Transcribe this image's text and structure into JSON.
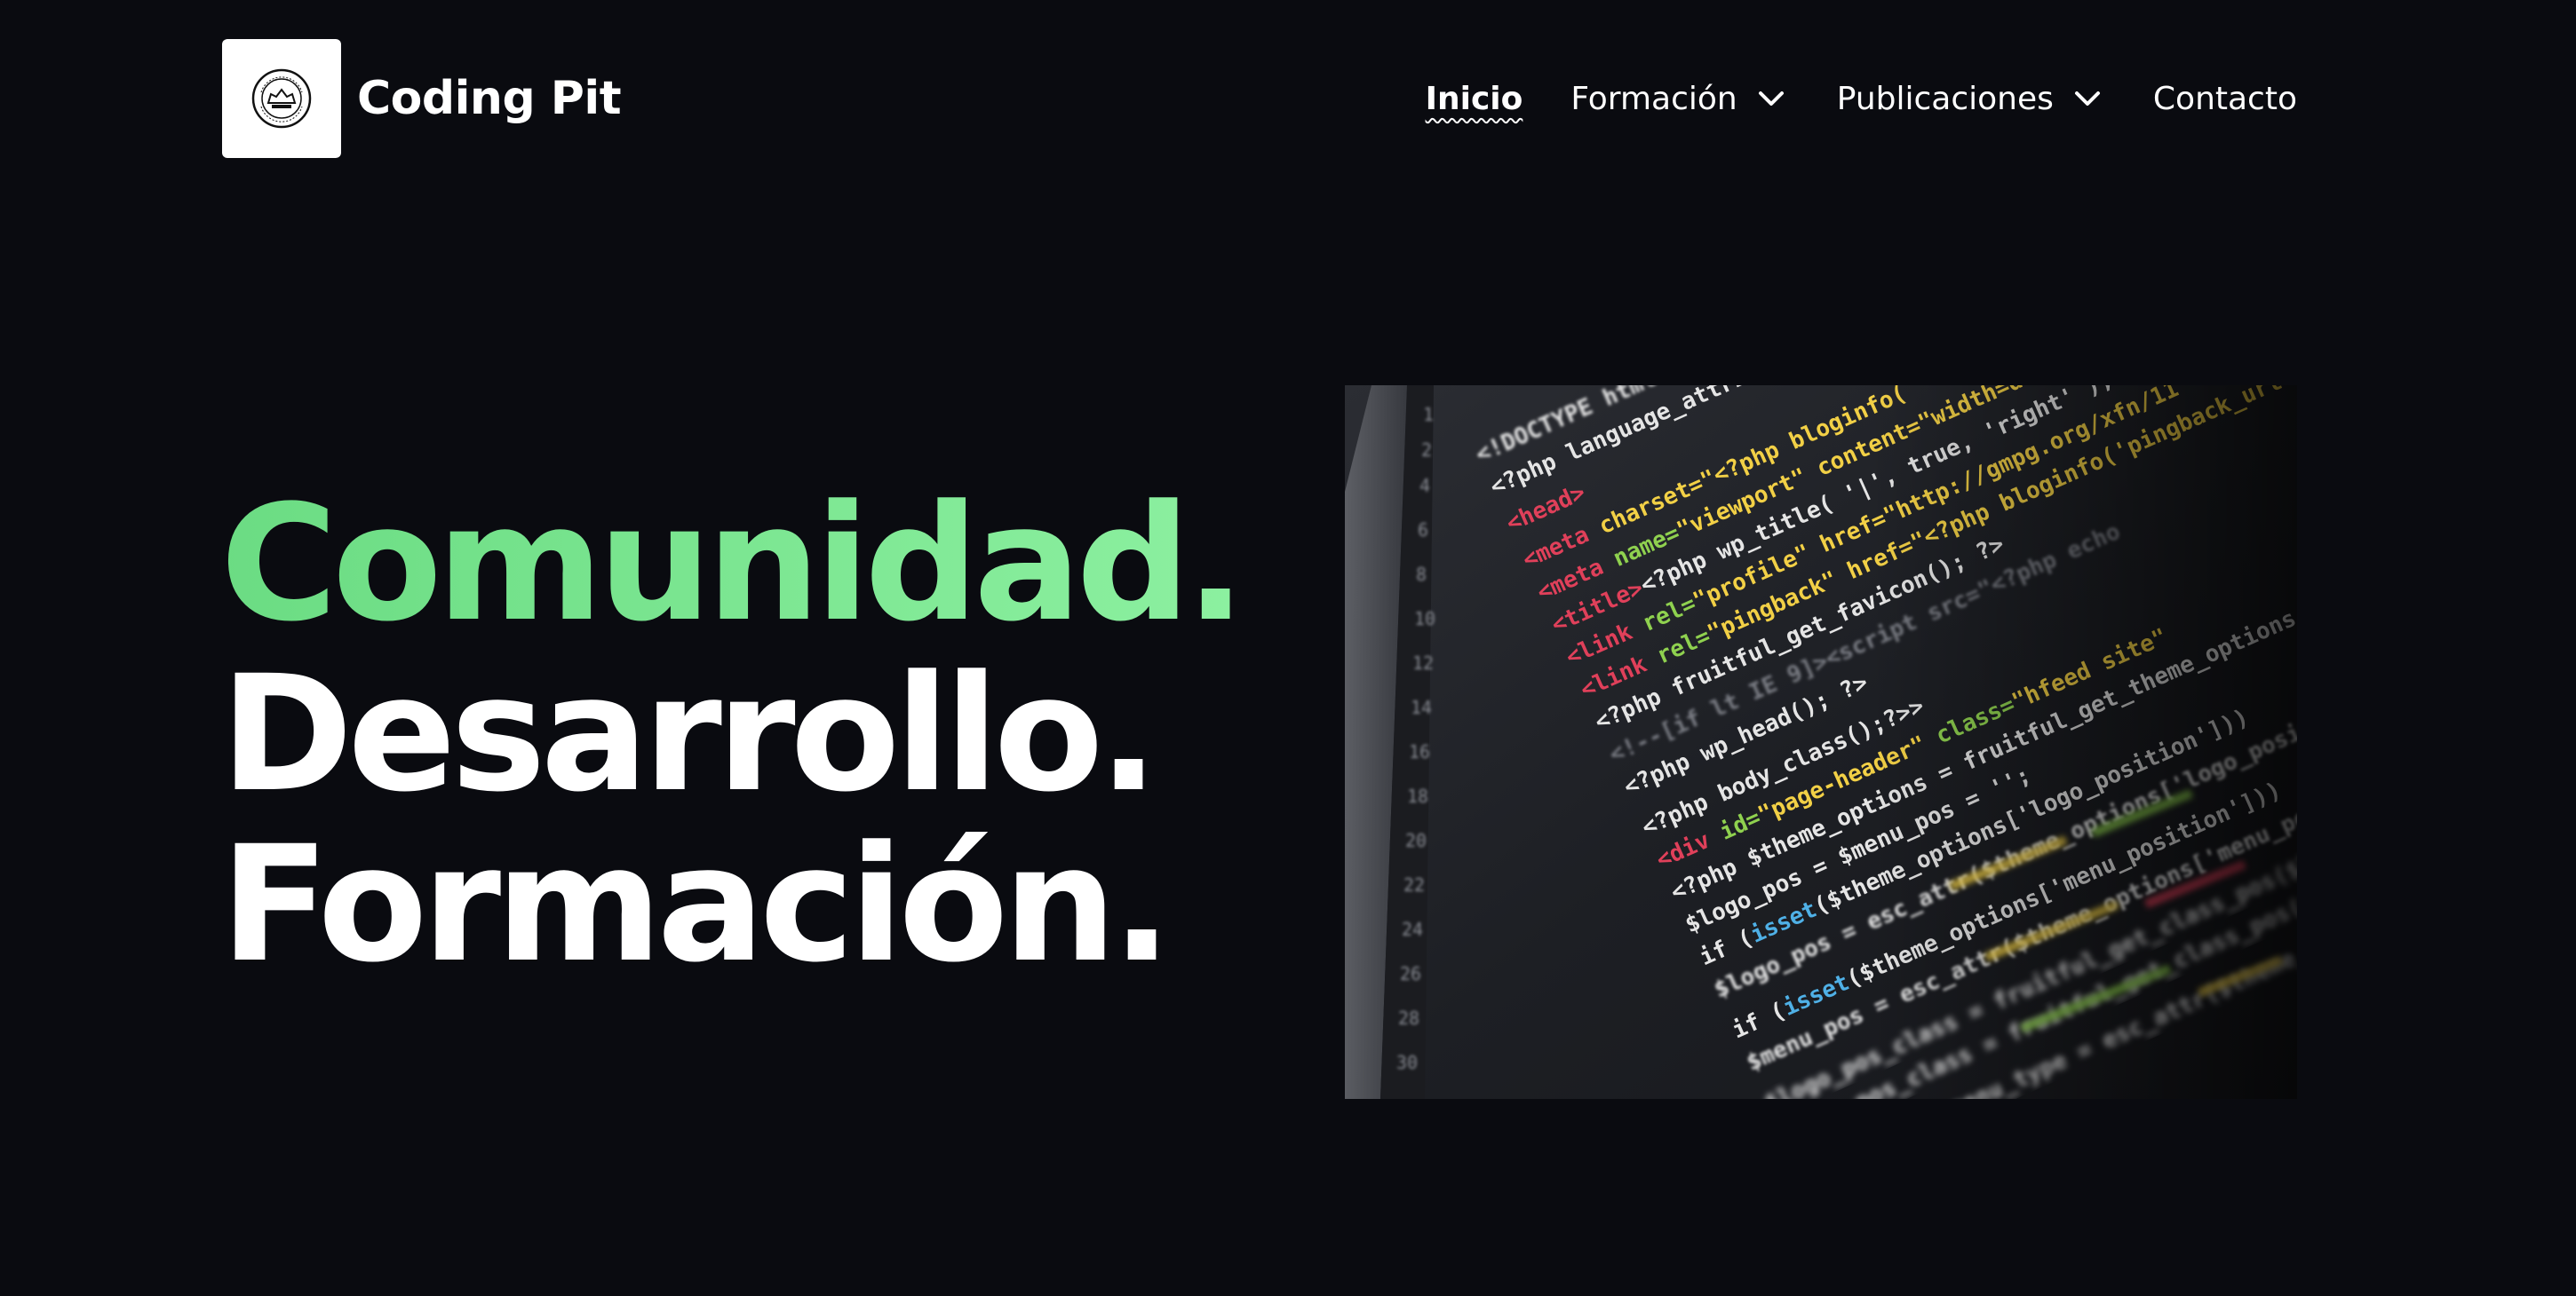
{
  "header": {
    "site_title": "Coding Pit",
    "logo_icon": "coding-pit-seal-logo",
    "nav": [
      {
        "label": "Inicio",
        "active": true,
        "dropdown": false
      },
      {
        "label": "Formación",
        "active": false,
        "dropdown": true
      },
      {
        "label": "Publicaciones",
        "active": false,
        "dropdown": true
      },
      {
        "label": "Contacto",
        "active": false,
        "dropdown": false
      }
    ]
  },
  "hero": {
    "line1": "Comunidad.",
    "line2": "Desarrollo.",
    "line3": "Formación.",
    "image_icon": "code-screenshot-image"
  },
  "colors": {
    "background": "#0a0b10",
    "accent_green": "#7ee895",
    "text": "#ffffff"
  }
}
